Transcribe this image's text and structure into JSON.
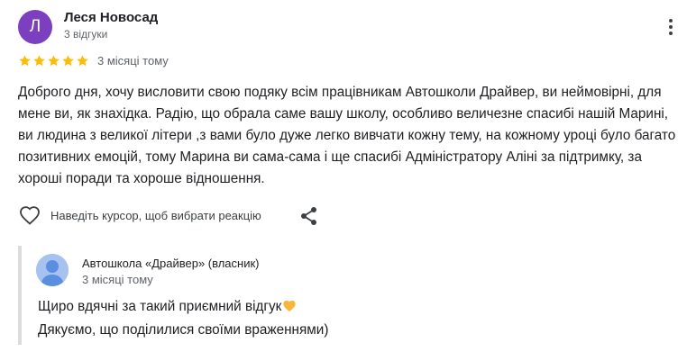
{
  "review": {
    "author_initial": "Л",
    "author_name": "Леся Новосад",
    "author_meta": "3 відгуки",
    "avatar_color": "#7b3fbf",
    "rating": 5,
    "rating_max": 5,
    "star_color": "#fbbc04",
    "date": "3 місяці тому",
    "text": "Доброго дня, хочу висловити свою подяку всім працівникам Автошколи Драйвер, ви неймовірні, для мене ви, як знахідка. Радію, що обрала саме вашу школу, особливо величезне спасибі нашій Марині, ви людина з великої літери ,з вами було дуже легко вивчати кожну тему, на кожному уроці було багато позитивних емоцій, тому Марина ви сама-сама і ще спасибі Адміністратору Аліні за підтримку, за хороші поради та хороше відношення.",
    "icons": {
      "more": "more-vert-icon",
      "like": "heart-outline-icon",
      "share": "share-icon"
    }
  },
  "actions": {
    "reaction_hint": "Наведіть курсор, щоб вибрати реакцію"
  },
  "reply": {
    "owner_name": "Автошкола «Драйвер» (власник)",
    "date": "3 місяці тому",
    "line1": "Щиро вдячні за такий приємний відгук",
    "emoji": "yellow-heart",
    "line2": "Дякуємо, що поділилися своїми враженнями)",
    "avatar_icon": "person-avatar-icon"
  }
}
